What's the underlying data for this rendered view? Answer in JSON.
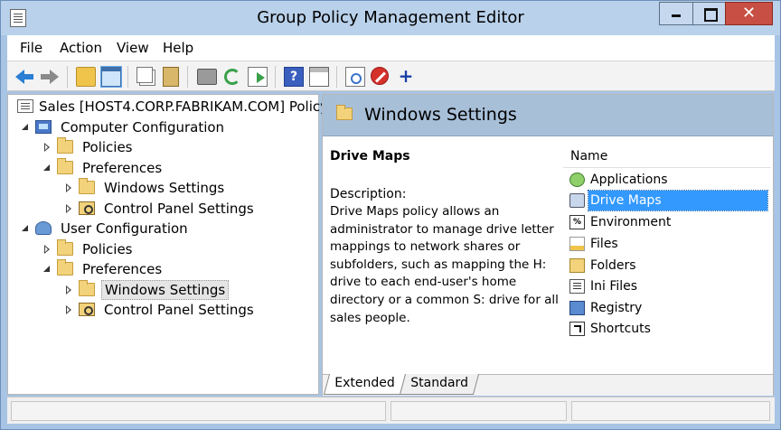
{
  "window": {
    "title": "Group Policy Management Editor"
  },
  "menu": {
    "file": "File",
    "action": "Action",
    "view": "View",
    "help": "Help"
  },
  "toolbar": {
    "icons": [
      "back-icon",
      "forward-icon",
      "up-folder-icon",
      "show-hide-tree-icon",
      "copy-icon",
      "paste-icon",
      "print-icon",
      "refresh-icon",
      "export-list-icon",
      "help-icon",
      "properties-icon",
      "filter-icon",
      "stop-icon",
      "add-icon"
    ],
    "help_glyph": "?",
    "add_glyph": "+"
  },
  "tree": {
    "root": "Sales [HOST4.CORP.FABRIKAM.COM] Policy",
    "computer_config": "Computer Configuration",
    "cc_policies": "Policies",
    "cc_preferences": "Preferences",
    "cc_windows_settings": "Windows Settings",
    "cc_control_panel": "Control Panel Settings",
    "user_config": "User Configuration",
    "uc_policies": "Policies",
    "uc_preferences": "Preferences",
    "uc_windows_settings": "Windows Settings",
    "uc_control_panel": "Control Panel Settings",
    "selected": "uc_windows_settings"
  },
  "right": {
    "header": "Windows Settings",
    "detail_title": "Drive Maps",
    "description_label": "Description:",
    "description": "Drive Maps policy allows an administrator to manage drive letter mappings to network shares or subfolders, such as mapping the H: drive to each end-user's home directory or a common S: drive for all sales people.",
    "list_header": "Name",
    "items": [
      {
        "label": "Applications",
        "icon": "applications-icon"
      },
      {
        "label": "Drive Maps",
        "icon": "drive-maps-icon",
        "selected": true
      },
      {
        "label": "Environment",
        "icon": "environment-icon",
        "glyph": "%"
      },
      {
        "label": "Files",
        "icon": "files-icon"
      },
      {
        "label": "Folders",
        "icon": "folders-icon"
      },
      {
        "label": "Ini Files",
        "icon": "ini-files-icon"
      },
      {
        "label": "Registry",
        "icon": "registry-icon"
      },
      {
        "label": "Shortcuts",
        "icon": "shortcuts-icon"
      }
    ]
  },
  "tabs": {
    "extended": "Extended",
    "standard": "Standard",
    "active": "extended"
  },
  "colors": {
    "selection": "#3399ff",
    "header_band": "#a8bfd8",
    "window_frame": "#a8c4e4",
    "close_button": "#c74f43"
  }
}
